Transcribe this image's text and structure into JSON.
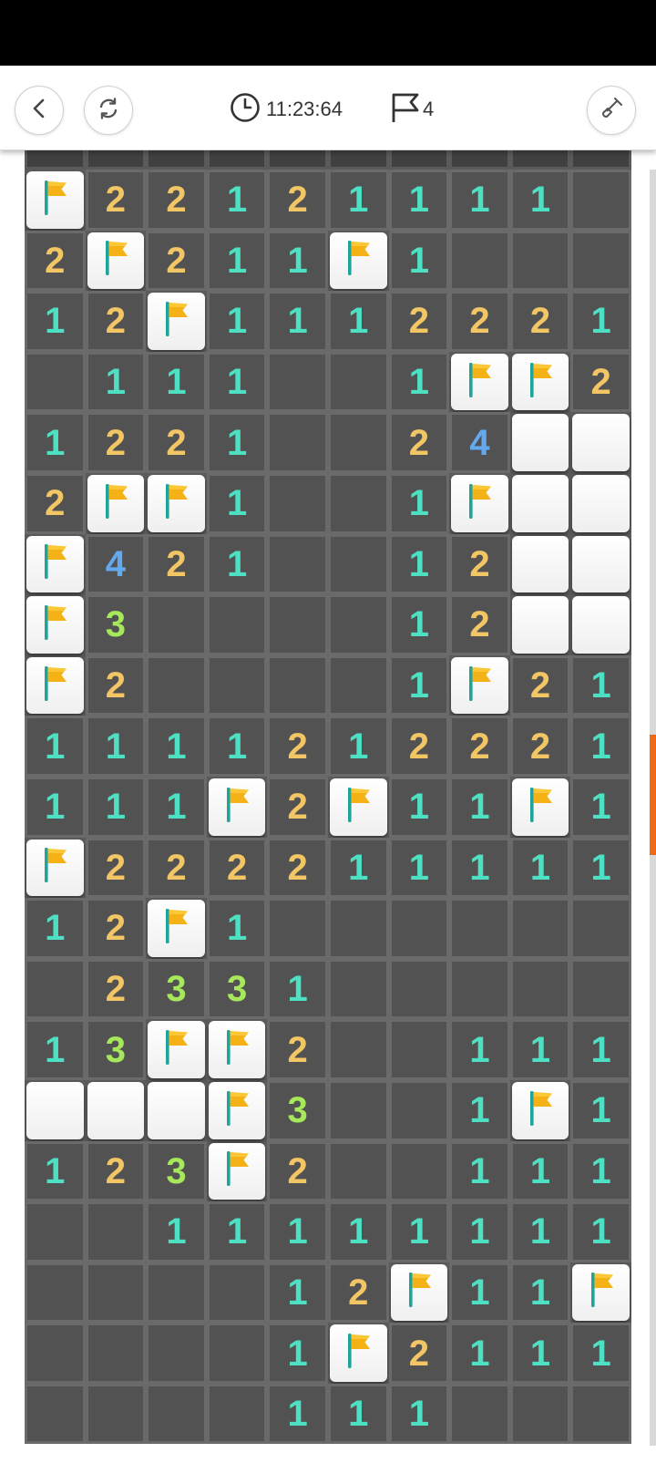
{
  "header": {
    "back_icon": "chevron-left-icon",
    "restart_icon": "refresh-icon",
    "timer": "11:23:64",
    "timer_icon": "clock-icon",
    "flags_left": "4",
    "flag_icon": "flag-icon",
    "tool_icon": "shovel-icon"
  },
  "colors": {
    "one": "#4ee0c2",
    "two": "#f2c665",
    "three": "#a6e85a",
    "four": "#63a9f0",
    "flag": "#f5b216",
    "pole": "#1fa39a",
    "board": "#5a5a5a",
    "accent": "#f06a14"
  },
  "board": {
    "rows": [
      "F22121111",
      "2F211F1   ",
      "12F1112221",
      " 111  1FF2",
      "1221  24  ",
      "2FF1  1F  ",
      "F421  12  ",
      "F3    12  ",
      "F2    1F21",
      "1111212221",
      "111F2F11F1",
      "F222211111",
      "12F1      ",
      " 2331     ",
      "13FF2  111",
      "   F3  1F1",
      "123F2  111",
      "  11111111",
      "    12F11F",
      "    1F2111",
      "    111   "
    ]
  }
}
